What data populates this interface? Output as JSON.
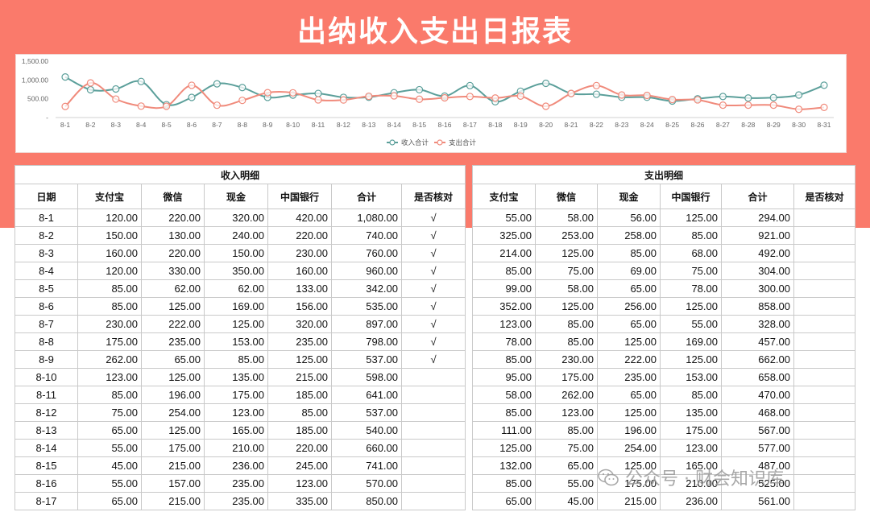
{
  "title": "出纳收入支出日报表",
  "colors": {
    "banner": "#fa7a6b",
    "income_line": "#5b9f9a",
    "expense_line": "#f08a7b"
  },
  "chart_data": {
    "type": "line",
    "categories": [
      "8-1",
      "8-2",
      "8-3",
      "8-4",
      "8-5",
      "8-6",
      "8-7",
      "8-8",
      "8-9",
      "8-10",
      "8-11",
      "8-12",
      "8-13",
      "8-14",
      "8-15",
      "8-16",
      "8-17",
      "8-18",
      "8-19",
      "8-20",
      "8-21",
      "8-22",
      "8-23",
      "8-24",
      "8-25",
      "8-26",
      "8-27",
      "8-28",
      "8-29",
      "8-30",
      "8-31"
    ],
    "yticks": [
      "1,500.00",
      "1,000.00",
      "500.00",
      "-"
    ],
    "ylim": [
      0,
      1500
    ],
    "series": [
      {
        "name": "收入合计",
        "color": "#5b9f9a",
        "values": [
          1080,
          740,
          760,
          960,
          342,
          535,
          897,
          798,
          537,
          598,
          641,
          537,
          540,
          660,
          741,
          570,
          850,
          420,
          700,
          910,
          640,
          620,
          540,
          540,
          440,
          500,
          560,
          520,
          530,
          600,
          860
        ]
      },
      {
        "name": "支出合计",
        "color": "#f08a7b",
        "values": [
          294,
          921,
          492,
          304,
          300,
          858,
          328,
          457,
          662,
          658,
          470,
          468,
          567,
          577,
          487,
          525,
          560,
          520,
          570,
          300,
          640,
          850,
          600,
          590,
          480,
          470,
          330,
          330,
          330,
          220,
          270
        ]
      }
    ],
    "legend": "bottom-center"
  },
  "income": {
    "section": "收入明细",
    "headers": [
      "日期",
      "支付宝",
      "微信",
      "现金",
      "中国银行",
      "合计",
      "是否核对"
    ],
    "rows": [
      [
        "8-1",
        "120.00",
        "220.00",
        "320.00",
        "420.00",
        "1,080.00",
        "√"
      ],
      [
        "8-2",
        "150.00",
        "130.00",
        "240.00",
        "220.00",
        "740.00",
        "√"
      ],
      [
        "8-3",
        "160.00",
        "220.00",
        "150.00",
        "230.00",
        "760.00",
        "√"
      ],
      [
        "8-4",
        "120.00",
        "330.00",
        "350.00",
        "160.00",
        "960.00",
        "√"
      ],
      [
        "8-5",
        "85.00",
        "62.00",
        "62.00",
        "133.00",
        "342.00",
        "√"
      ],
      [
        "8-6",
        "85.00",
        "125.00",
        "169.00",
        "156.00",
        "535.00",
        "√"
      ],
      [
        "8-7",
        "230.00",
        "222.00",
        "125.00",
        "320.00",
        "897.00",
        "√"
      ],
      [
        "8-8",
        "175.00",
        "235.00",
        "153.00",
        "235.00",
        "798.00",
        "√"
      ],
      [
        "8-9",
        "262.00",
        "65.00",
        "85.00",
        "125.00",
        "537.00",
        "√"
      ],
      [
        "8-10",
        "123.00",
        "125.00",
        "135.00",
        "215.00",
        "598.00",
        ""
      ],
      [
        "8-11",
        "85.00",
        "196.00",
        "175.00",
        "185.00",
        "641.00",
        ""
      ],
      [
        "8-12",
        "75.00",
        "254.00",
        "123.00",
        "85.00",
        "537.00",
        ""
      ],
      [
        "8-13",
        "65.00",
        "125.00",
        "165.00",
        "185.00",
        "540.00",
        ""
      ],
      [
        "8-14",
        "55.00",
        "175.00",
        "210.00",
        "220.00",
        "660.00",
        ""
      ],
      [
        "8-15",
        "45.00",
        "215.00",
        "236.00",
        "245.00",
        "741.00",
        ""
      ],
      [
        "8-16",
        "55.00",
        "157.00",
        "235.00",
        "123.00",
        "570.00",
        ""
      ],
      [
        "8-17",
        "65.00",
        "215.00",
        "235.00",
        "335.00",
        "850.00",
        ""
      ]
    ]
  },
  "expense": {
    "section": "支出明细",
    "headers": [
      "支付宝",
      "微信",
      "现金",
      "中国银行",
      "合计",
      "是否核对"
    ],
    "rows": [
      [
        "55.00",
        "58.00",
        "56.00",
        "125.00",
        "294.00",
        ""
      ],
      [
        "325.00",
        "253.00",
        "258.00",
        "85.00",
        "921.00",
        ""
      ],
      [
        "214.00",
        "125.00",
        "85.00",
        "68.00",
        "492.00",
        ""
      ],
      [
        "85.00",
        "75.00",
        "69.00",
        "75.00",
        "304.00",
        ""
      ],
      [
        "99.00",
        "58.00",
        "65.00",
        "78.00",
        "300.00",
        ""
      ],
      [
        "352.00",
        "125.00",
        "256.00",
        "125.00",
        "858.00",
        ""
      ],
      [
        "123.00",
        "85.00",
        "65.00",
        "55.00",
        "328.00",
        ""
      ],
      [
        "78.00",
        "85.00",
        "125.00",
        "169.00",
        "457.00",
        ""
      ],
      [
        "85.00",
        "230.00",
        "222.00",
        "125.00",
        "662.00",
        ""
      ],
      [
        "95.00",
        "175.00",
        "235.00",
        "153.00",
        "658.00",
        ""
      ],
      [
        "58.00",
        "262.00",
        "65.00",
        "85.00",
        "470.00",
        ""
      ],
      [
        "85.00",
        "123.00",
        "125.00",
        "135.00",
        "468.00",
        ""
      ],
      [
        "111.00",
        "85.00",
        "196.00",
        "175.00",
        "567.00",
        ""
      ],
      [
        "125.00",
        "75.00",
        "254.00",
        "123.00",
        "577.00",
        ""
      ],
      [
        "132.00",
        "65.00",
        "125.00",
        "165.00",
        "487.00",
        ""
      ],
      [
        "85.00",
        "55.00",
        "175.00",
        "210.00",
        "525.00",
        ""
      ],
      [
        "65.00",
        "45.00",
        "215.00",
        "236.00",
        "561.00",
        ""
      ]
    ]
  },
  "watermark": {
    "text": "公众号 · 财会知识库",
    "icon": "wechat-icon"
  }
}
